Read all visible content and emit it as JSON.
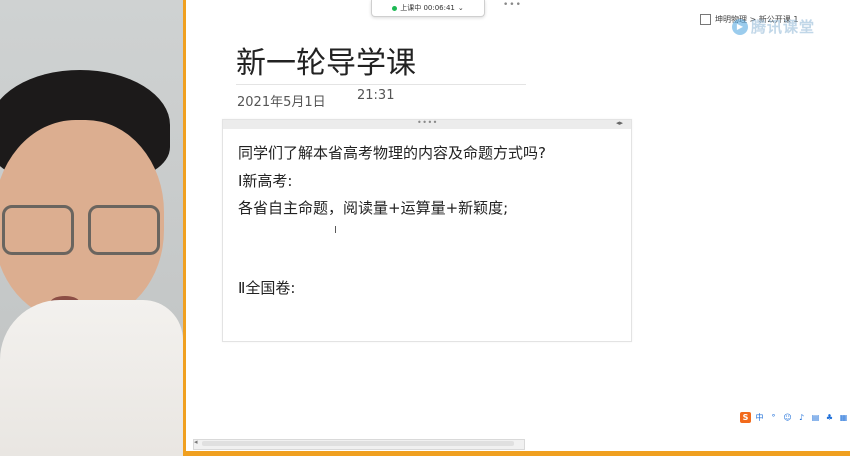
{
  "top_bar": {
    "recording_label": "上课中 00:06:41",
    "more": "•••"
  },
  "breadcrumb": "坤明物理 > 新公开课 1",
  "watermark": "腾讯课堂",
  "page": {
    "title": "新一轮导学课",
    "date": "2021年5月1日",
    "time": "21:31"
  },
  "note": {
    "grip": "••••",
    "nav": "◂▸",
    "lines": [
      "同学们了解本省高考物理的内容及命题方式吗?",
      "Ⅰ新高考:",
      "各省自主命题，阅读量+运算量+新颖度;",
      "Ⅱ全国卷:"
    ]
  },
  "text_cursor": "I",
  "tray": {
    "ime_s": "S",
    "ime_lang": "中"
  },
  "colors": {
    "frame": "#f0a020",
    "recording_dot": "#1db954"
  }
}
